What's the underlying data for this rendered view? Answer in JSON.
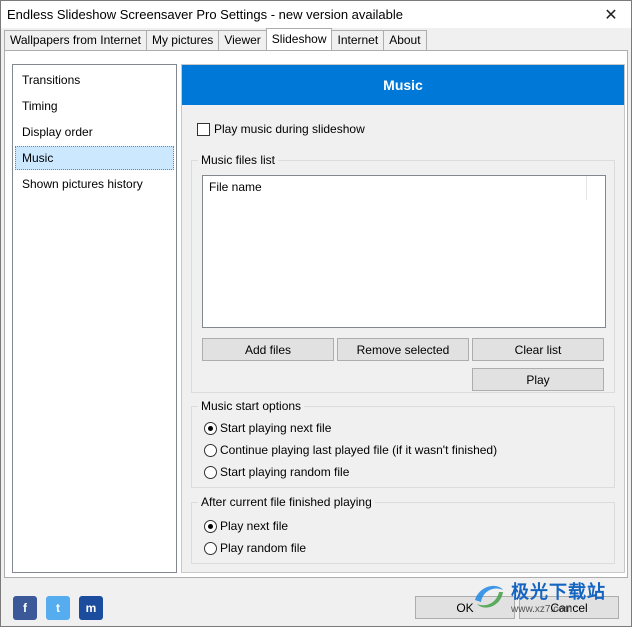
{
  "window": {
    "title": "Endless Slideshow Screensaver Pro Settings - new version available",
    "close_glyph": "✕"
  },
  "tabs": [
    {
      "label": "Wallpapers from Internet"
    },
    {
      "label": "My pictures"
    },
    {
      "label": "Viewer"
    },
    {
      "label": "Slideshow",
      "active": true
    },
    {
      "label": "Internet"
    },
    {
      "label": "About"
    }
  ],
  "sidebar": {
    "items": [
      {
        "label": "Transitions"
      },
      {
        "label": "Timing"
      },
      {
        "label": "Display order"
      },
      {
        "label": "Music",
        "selected": true
      },
      {
        "label": "Shown pictures history"
      }
    ]
  },
  "content": {
    "header": "Music",
    "play_music_checkbox": {
      "label": "Play music during slideshow",
      "checked": false
    },
    "music_files": {
      "group_label": "Music files list",
      "column_header": "File name",
      "buttons": {
        "add": "Add files",
        "remove": "Remove selected",
        "clear": "Clear list",
        "play": "Play"
      }
    },
    "start_options": {
      "group_label": "Music start options",
      "options": [
        {
          "label": "Start playing next file",
          "checked": true
        },
        {
          "label": "Continue playing last played file (if it wasn't finished)",
          "checked": false
        },
        {
          "label": "Start playing random file",
          "checked": false
        }
      ]
    },
    "after_finished": {
      "group_label": "After current file finished playing",
      "options": [
        {
          "label": "Play next file",
          "checked": true
        },
        {
          "label": "Play random file",
          "checked": false
        }
      ]
    }
  },
  "footer": {
    "ok": "OK",
    "cancel": "Cancel",
    "social": [
      {
        "icon": "facebook-icon",
        "glyph": "f",
        "color": "#3b5998"
      },
      {
        "icon": "twitter-icon",
        "glyph": "t",
        "color": "#55acee"
      },
      {
        "icon": "myspace-icon",
        "glyph": "m",
        "color": "#1c4c9e"
      }
    ]
  },
  "watermark": {
    "text": "极光下载站",
    "url": "www.xz7.com"
  },
  "colors": {
    "accent": "#0078d7",
    "selection": "#cce8ff"
  }
}
